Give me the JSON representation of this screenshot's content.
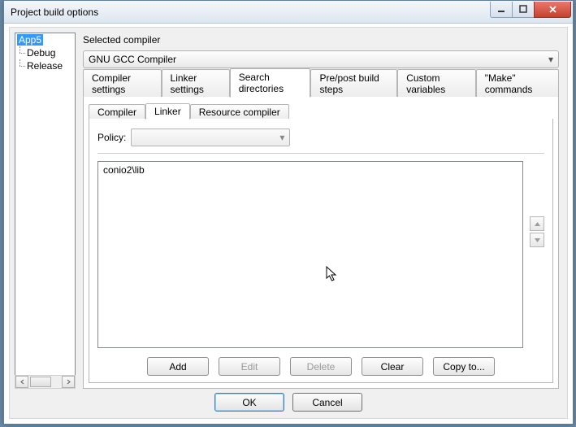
{
  "window": {
    "title": "Project build options"
  },
  "tree": {
    "root": "App5",
    "children": [
      "Debug",
      "Release"
    ]
  },
  "right": {
    "selected_compiler_label": "Selected compiler",
    "selected_compiler_value": "GNU GCC Compiler"
  },
  "tabs_main": {
    "items": [
      "Compiler settings",
      "Linker settings",
      "Search directories",
      "Pre/post build steps",
      "Custom variables",
      "\"Make\" commands"
    ],
    "active_index": 2
  },
  "tabs_sub": {
    "items": [
      "Compiler",
      "Linker",
      "Resource compiler"
    ],
    "active_index": 1
  },
  "policy": {
    "label": "Policy:",
    "value": ""
  },
  "list": {
    "items": [
      "conio2\\lib"
    ]
  },
  "buttons": {
    "add": "Add",
    "edit": "Edit",
    "delete": "Delete",
    "clear": "Clear",
    "copy_to": "Copy to..."
  },
  "dialog_buttons": {
    "ok": "OK",
    "cancel": "Cancel"
  }
}
